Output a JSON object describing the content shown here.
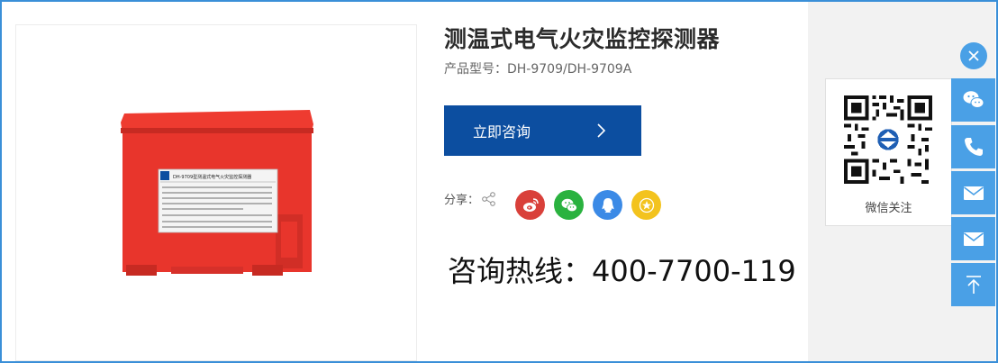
{
  "product": {
    "title": "测温式电气火灾监控探测器",
    "model_label": "产品型号：",
    "model_value": "DH-9709/DH-9709A",
    "label_header": "DH-9709型测温式电气火灾监控探测器"
  },
  "actions": {
    "consult_label": "立即咨询",
    "share_label": "分享："
  },
  "share_buttons": [
    {
      "name": "weibo",
      "color": "#d9403a"
    },
    {
      "name": "wechat",
      "color": "#2ab23f"
    },
    {
      "name": "qq",
      "color": "#3b8ae6"
    },
    {
      "name": "favorite",
      "color": "#f3c31e"
    }
  ],
  "hotline": {
    "text": "咨询热线：400-7700-119"
  },
  "sidebar": {
    "qr_caption": "微信关注",
    "buttons": [
      "wechat",
      "phone",
      "email",
      "email",
      "back-to-top"
    ]
  },
  "colors": {
    "primary": "#0c4ea0",
    "side_accent": "#4aa0e6",
    "product_red": "#e8352c"
  }
}
